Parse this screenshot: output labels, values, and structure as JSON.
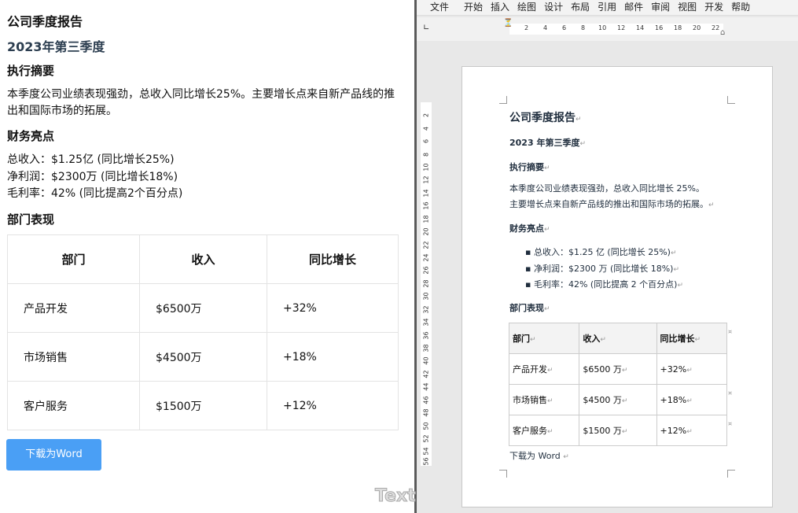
{
  "web": {
    "title": "公司季度报告",
    "subtitle": "2023年第三季度",
    "summary_heading": "执行摘要",
    "summary_text": "本季度公司业绩表现强劲，总收入同比增长25%。主要增长点来自新产品线的推出和国际市场的拓展。",
    "highlights_heading": "财务亮点",
    "highlights": [
      "总收入：$1.25亿 (同比增长25%)",
      "净利润：$2300万 (同比增长18%)",
      "毛利率：42% (同比提高2个百分点)"
    ],
    "dept_heading": "部门表现",
    "table_headers": [
      "部门",
      "收入",
      "同比增长"
    ],
    "table_rows": [
      [
        "产品开发",
        "$6500万",
        "+32%"
      ],
      [
        "市场销售",
        "$4500万",
        "+18%"
      ],
      [
        "客户服务",
        "$1500万",
        "+12%"
      ]
    ],
    "download_label": "下载为Word"
  },
  "word": {
    "ribbon_tabs": [
      "文件",
      "开始",
      "插入",
      "绘图",
      "设计",
      "布局",
      "引用",
      "邮件",
      "审阅",
      "视图",
      "开发",
      "帮助"
    ],
    "ruler_h": [
      "2",
      "4",
      "6",
      "8",
      "10",
      "12",
      "14",
      "16",
      "18",
      "20",
      "22"
    ],
    "ruler_v": [
      "2",
      "4",
      "6",
      "8",
      "10",
      "12",
      "14",
      "16",
      "18",
      "20",
      "22",
      "24",
      "26",
      "28",
      "30",
      "32",
      "34",
      "36",
      "38",
      "40",
      "42",
      "44",
      "46",
      "48",
      "50",
      "52",
      "54",
      "56"
    ],
    "title": "公司季度报告",
    "subtitle": "2023 年第三季度",
    "summary_heading": "执行摘要",
    "summary_line1": "本季度公司业绩表现强劲，总收入同比增长 25%。",
    "summary_line2": "主要增长点来自新产品线的推出和国际市场的拓展。",
    "highlights_heading": "财务亮点",
    "highlights": [
      "总收入：$1.25 亿 (同比增长 25%)",
      "净利润：$2300 万 (同比增长 18%)",
      "毛利率：42% (同比提高 2 个百分点)"
    ],
    "dept_heading": "部门表现",
    "table_headers": [
      "部门",
      "收入",
      "同比增长"
    ],
    "table_rows": [
      [
        "产品开发",
        "$6500 万",
        "+32%"
      ],
      [
        "市场销售",
        "$4500 万",
        "+18%"
      ],
      [
        "客户服务",
        "$1500 万",
        "+12%"
      ]
    ],
    "footer_text": "下载为 Word",
    "watermark": "Text",
    "para_mark": "↵",
    "cell_mark": "¤"
  },
  "colors": {
    "button": "#4a9ff5",
    "subtitle": "#2c3e50"
  }
}
